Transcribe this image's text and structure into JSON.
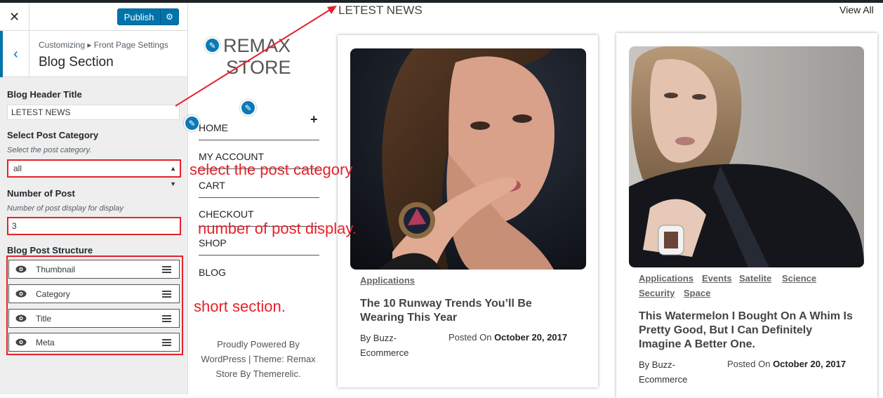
{
  "customizer": {
    "publish_label": "Publish",
    "breadcrumb": "Customizing ▸ Front Page Settings",
    "section_title": "Blog Section",
    "fields": {
      "header_title_label": "Blog Header Title",
      "header_title_value": "LETEST NEWS",
      "category_label": "Select Post Category",
      "category_desc": "Select the post category.",
      "category_value": "all",
      "number_label": "Number of Post",
      "number_desc": "Number of post display for display",
      "number_value": "3",
      "structure_label": "Blog Post Structure"
    },
    "structure_items": [
      "Thumbnail",
      "Category",
      "Title",
      "Meta"
    ]
  },
  "site": {
    "logo_line1": "REMAX",
    "logo_line2": "STORE",
    "nav": [
      "HOME",
      "MY ACCOUNT",
      "CART",
      "CHECKOUT",
      "SHOP",
      "BLOG"
    ],
    "footer_line1": "Proudly Powered By",
    "footer_line2": "WordPress | Theme: Remax",
    "footer_line3": "Store By Themerelic.",
    "news_title": "LETEST NEWS",
    "view_all": "View All",
    "posts": [
      {
        "categories": [
          "Applications"
        ],
        "title_line1": "The 10 Runway Trends You’ll Be",
        "title_line2": "Wearing This Year",
        "by_line1": "By Buzz-",
        "by_line2": "Ecommerce",
        "posted_on": "Posted On",
        "date": "October 20, 2017"
      },
      {
        "categories": [
          "Applications",
          "Events",
          "Satelite",
          "Science",
          "Security",
          "Space"
        ],
        "title_line1": "This Watermelon I Bought On A Whim Is",
        "title_line2": "Pretty Good, But I Can Definitely",
        "title_line3": "Imagine A Better One.",
        "by_line1": "By Buzz-",
        "by_line2": "Ecommerce",
        "posted_on": "Posted On",
        "date": "October 20, 2017"
      }
    ]
  },
  "annotations": {
    "category": "select the post category",
    "number": "number of post display.",
    "structure": "short section."
  },
  "colors": {
    "accent": "#0073aa",
    "annotation": "#e4222a"
  }
}
